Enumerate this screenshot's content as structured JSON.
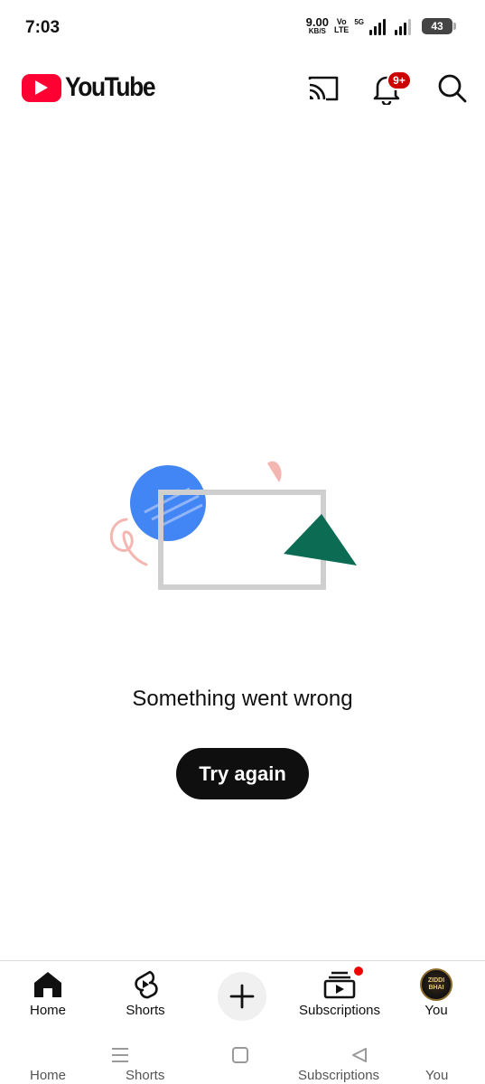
{
  "status_bar": {
    "time": "7:03",
    "net_speed_value": "9.00",
    "net_speed_unit": "KB/S",
    "volte_top": "Vo",
    "volte_bottom": "LTE",
    "network_type": "5G",
    "battery": "43"
  },
  "app_bar": {
    "logo_text": "YouTube",
    "notification_badge": "9+"
  },
  "error": {
    "message": "Something went wrong",
    "button_label": "Try again"
  },
  "bottom_nav": {
    "items": [
      {
        "label": "Home",
        "icon": "home-icon"
      },
      {
        "label": "Shorts",
        "icon": "shorts-icon"
      },
      {
        "label": "",
        "icon": "plus-icon"
      },
      {
        "label": "Subscriptions",
        "icon": "subscriptions-icon"
      },
      {
        "label": "You",
        "icon": "avatar"
      }
    ],
    "avatar_text_line1": "ZIDDI",
    "avatar_text_line2": "BHAI"
  },
  "ghost_labels": [
    "Home",
    "Shorts",
    "Subscriptions",
    "You"
  ],
  "colors": {
    "brand_red": "#ff0033",
    "badge_red": "#cc0000",
    "illustration_blue": "#4285f4",
    "illustration_green": "#0b6b53",
    "illustration_pink": "#f4b6b0",
    "frame_gray": "#cfcfcf"
  }
}
